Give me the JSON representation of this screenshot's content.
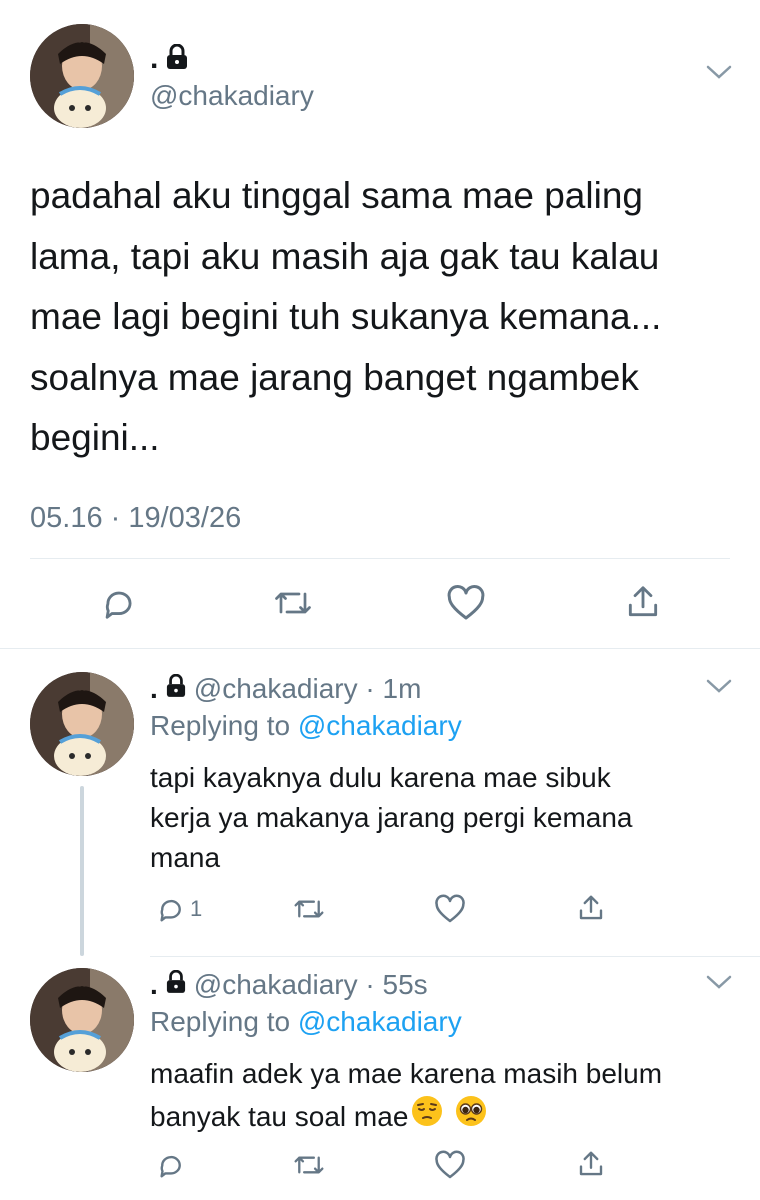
{
  "main_tweet": {
    "display_name": ".",
    "handle": "@chakadiary",
    "text_lines": [
      "padahal aku tinggal sama mae paling",
      "lama, tapi aku masih aja gak tau kalau",
      "mae lagi begini tuh sukanya kemana...",
      "soalnya mae jarang banget ngambek",
      "begini..."
    ],
    "timestamp": "05.16 · 19/03/26"
  },
  "replies": [
    {
      "display_name": ".",
      "handle_time": "@chakadiary · 1m",
      "replying_prefix": "Replying to ",
      "replying_to": "@chakadiary",
      "text_lines": [
        "tapi kayaknya dulu karena mae sibuk",
        "kerja ya makanya jarang pergi kemana",
        "mana"
      ],
      "reply_count": "1"
    },
    {
      "display_name": ".",
      "handle_time": "@chakadiary · 55s",
      "replying_prefix": "Replying to ",
      "replying_to": "@chakadiary",
      "text_lines": [
        "maafin adek ya mae karena masih belum",
        "banyak tau soal mae"
      ],
      "emojis": [
        "pensive-face",
        "pleading-face"
      ],
      "reply_count": ""
    }
  ],
  "colors": {
    "text": "#14171a",
    "muted": "#657786",
    "link": "#1da1f2",
    "divider": "#e6ecf0",
    "thread_line": "#ccd6dd"
  },
  "icons": [
    "lock-icon",
    "chevron-down-icon",
    "reply-icon",
    "retweet-icon",
    "like-icon",
    "share-icon"
  ]
}
